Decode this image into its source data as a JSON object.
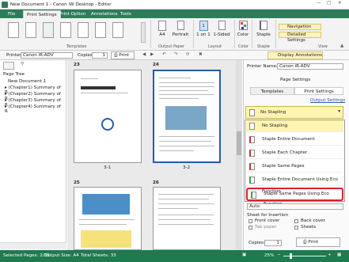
{
  "window": {
    "title": "New Document 1 - Canon iW Desktop - Editor"
  },
  "ribbon": {
    "tabs": [
      "File",
      "Print Settings",
      "Print Option",
      "Annotations",
      "Tools"
    ],
    "groups": {
      "templates": "Templates",
      "output_paper": "Output Paper",
      "layout": "Layout",
      "color": "Color",
      "staple": "Staple",
      "view": "View"
    },
    "buttons": {
      "paper_size": "A4",
      "orientation": "Portrait",
      "pages_per_sheet": "1",
      "pages_per_sheet_label": "1 on 1",
      "sided": "1-Sided",
      "color": "Color",
      "staple": "Staple",
      "navigation": "Navigation",
      "detailed_settings": "Detailed Settings",
      "display_annotations": "Display Annotations"
    }
  },
  "toolbar": {
    "printer_label": "Printer",
    "printer_value": "Canon iR-ADV",
    "copies_label": "Copies",
    "copies_value": "1",
    "print_label": "Print"
  },
  "left_pane": {
    "title": "Page Tree",
    "root": "New Document 1",
    "items": [
      "(Chapter1) Summary of R",
      "(Chapter2) Summary of R",
      "(Chapter3) Summary of R",
      "(Chapter4) Summary of R"
    ]
  },
  "pages": [
    {
      "number": "23",
      "caption": "3-1"
    },
    {
      "number": "24",
      "caption": "3-2"
    },
    {
      "number": "25",
      "caption": ""
    },
    {
      "number": "26",
      "caption": ""
    }
  ],
  "right_pane": {
    "printer_label": "Printer Name:",
    "printer_value": "Canon iR-ADV",
    "section_title": "Page Settings",
    "tabs": [
      "Templates",
      "Print Settings"
    ],
    "output_settings_link": "Output Settings",
    "staple_selected": "No Stapling",
    "dropdown_options": [
      "No Stapling",
      "Staple Entire Document",
      "Staple Each Chapter",
      "Staple Same Pages",
      "Staple Entire Document Using Eco Function",
      "Staple Same Pages Using Eco Function"
    ],
    "auto_value": "Auto",
    "sheet_insertion_label": "Sheet for Insertion",
    "front_cover": "Front cover",
    "back_cover": "Back cover",
    "tab_paper": "Tab paper",
    "sheets": "Sheets",
    "copies_label": "Copies:",
    "copies_value": "1",
    "print_label": "Print"
  },
  "statusbar": {
    "selected": "Selected Pages: 2/33",
    "output_size": "Output Size: A4",
    "total_sheets": "Total Sheets: 33",
    "zoom": "25%"
  },
  "colors": {
    "brand_green": "#2e7d5a",
    "status_green": "#1e7a4f",
    "highlight": "#fff4b0",
    "callout_red": "#d9232a"
  }
}
